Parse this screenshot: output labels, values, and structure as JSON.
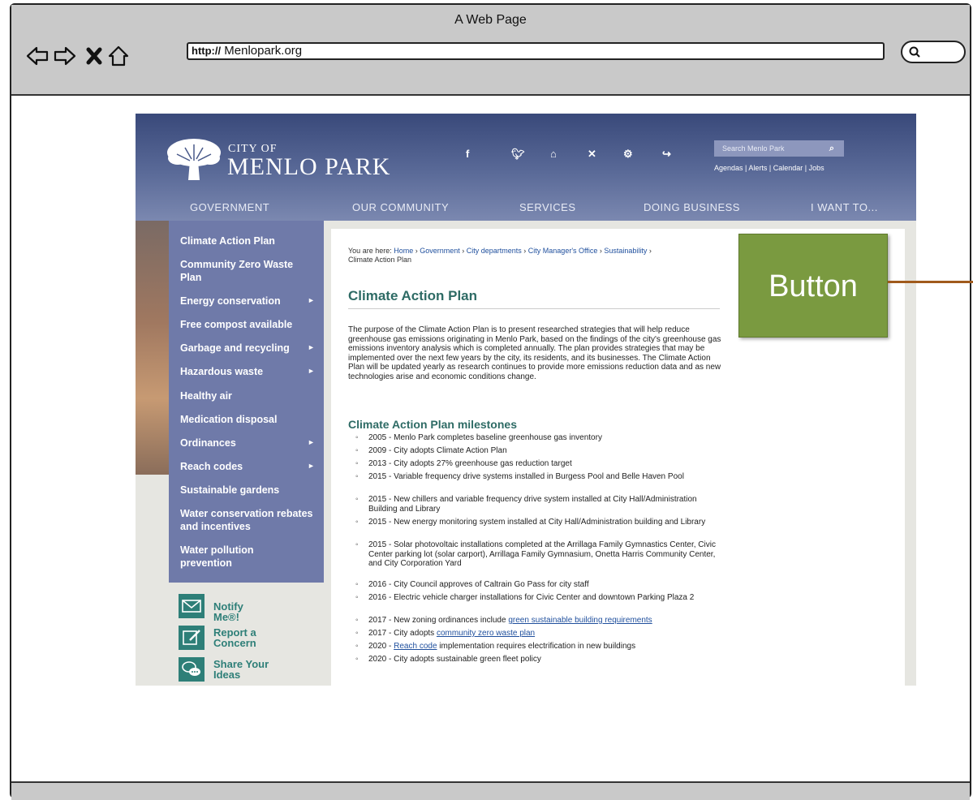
{
  "browser": {
    "window_title": "A Web Page",
    "url_protocol": "http://",
    "url": "Menlopark.org",
    "nav_icons": [
      "back-arrow-icon",
      "forward-arrow-icon",
      "stop-icon",
      "home-icon"
    ],
    "search_icon": "search-icon"
  },
  "site": {
    "logo": {
      "line1": "CITY OF",
      "line2": "MENLO PARK"
    },
    "social_icons": [
      "facebook-icon",
      "twitter-icon",
      "nextdoor-icon",
      "x-icon",
      "settings-icon",
      "share-icon"
    ],
    "search_placeholder": "Search Menlo Park",
    "quick_links": "Agendas  |  Alerts  |  Calendar  |  Jobs",
    "nav": [
      "GOVERNMENT",
      "OUR COMMUNITY",
      "SERVICES",
      "DOING BUSINESS",
      "I WANT TO..."
    ]
  },
  "sidebar": {
    "items": [
      {
        "label": "Climate Action Plan",
        "arrow": ""
      },
      {
        "label": "Community Zero Waste Plan",
        "arrow": ""
      },
      {
        "label": "Energy conservation",
        "arrow": "►"
      },
      {
        "label": "Free compost available",
        "arrow": ""
      },
      {
        "label": "Garbage and recycling",
        "arrow": "►"
      },
      {
        "label": "Hazardous waste",
        "arrow": "►"
      },
      {
        "label": "Healthy air",
        "arrow": ""
      },
      {
        "label": "Medication disposal",
        "arrow": ""
      },
      {
        "label": "Ordinances",
        "arrow": "►"
      },
      {
        "label": "Reach codes",
        "arrow": "►"
      },
      {
        "label": "Sustainable gardens",
        "arrow": ""
      },
      {
        "label": "Water conservation rebates and incentives",
        "arrow": ""
      },
      {
        "label": "Water pollution prevention",
        "arrow": ""
      }
    ],
    "actions": [
      {
        "label": "Notify Me®!",
        "icon": "envelope-icon"
      },
      {
        "label": "Report a Concern",
        "icon": "edit-icon"
      },
      {
        "label": "Share Your Ideas",
        "icon": "chat-bubbles-icon"
      }
    ]
  },
  "content": {
    "breadcrumb_prefix": "You are here: ",
    "breadcrumbs": [
      "Home",
      "Government",
      "City departments",
      "City Manager's Office",
      "Sustainability"
    ],
    "breadcrumb_current": "Climate Action Plan",
    "title": "Climate Action Plan",
    "intro": "The purpose of the Climate Action Plan is to present researched strategies that will help reduce greenhouse gas emissions originating in Menlo Park, based on the findings of the city's greenhouse gas emissions inventory analysis which is completed annually. The plan provides strategies that may be implemented over the next few years by the city, its residents, and its businesses. The Climate Action Plan will be updated yearly as research continues to provide more emissions reduction data and as new technologies arise and economic conditions change.",
    "milestones_title": "Climate Action Plan milestones",
    "milestones": [
      {
        "text": "2005 - Menlo Park completes baseline greenhouse gas inventory"
      },
      {
        "text": "2009 - City adopts Climate Action Plan"
      },
      {
        "text": "2013 - City adopts 27% greenhouse gas reduction target"
      },
      {
        "text": "2015 - Variable frequency drive systems installed in Burgess Pool and Belle Haven Pool"
      },
      {
        "text": "2015 - New chillers and variable frequency drive system installed at City Hall/Administration Building and Library"
      },
      {
        "text": "2015 - New energy monitoring system installed at City Hall/Administration building and Library"
      },
      {
        "text": "2015 - Solar photovoltaic installations completed at the Arrillaga Family Gymnastics Center, Civic Center parking lot (solar carport), Arrillaga Family Gymnasium, Onetta Harris Community Center, and City Corporation Yard"
      },
      {
        "text": "2016 - City Council approves of Caltrain Go Pass for city staff"
      },
      {
        "text": "2016 - Electric vehicle charger installations for Civic Center and downtown Parking Plaza 2"
      },
      {
        "pre": "2017 - New zoning ordinances include ",
        "link": "green sustainable building requirements",
        "post": ""
      },
      {
        "pre": "2017 - City adopts ",
        "link": "community zero waste plan",
        "post": ""
      },
      {
        "pre": "2020 - ",
        "link": "Reach code",
        "post": " implementation requires electrification in new buildings"
      },
      {
        "text": "2020 - City adopts sustainable green fleet policy"
      }
    ]
  },
  "overlay_button": {
    "label": "Button",
    "color": "#7a9a40"
  }
}
